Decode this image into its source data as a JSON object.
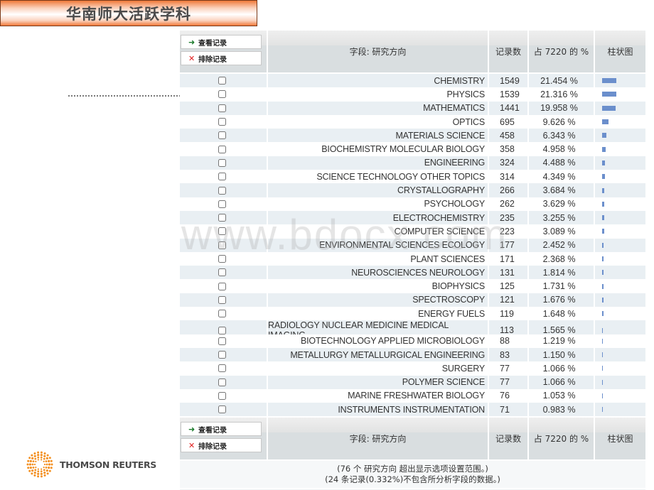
{
  "title": "华南师大活跃学科",
  "logo_text": "THOMSON REUTERS",
  "actions": {
    "view_records": "查看记录",
    "exclude_records": "排除记录"
  },
  "header": {
    "field": "字段: 研究方向",
    "count": "记录数",
    "percent": "占 7220 的 %",
    "bar": "柱状图"
  },
  "total_records": 7220,
  "bar_color": "#6b8fcc",
  "rows": [
    {
      "field": "CHEMISTRY",
      "count": "1549",
      "percent": "21.454 %",
      "pct_value": 21.454,
      "checked": false
    },
    {
      "field": "PHYSICS",
      "count": "1539",
      "percent": "21.316 %",
      "pct_value": 21.316,
      "checked": false
    },
    {
      "field": "MATHEMATICS",
      "count": "1441",
      "percent": "19.958 %",
      "pct_value": 19.958,
      "checked": false
    },
    {
      "field": "OPTICS",
      "count": "695",
      "percent": "9.626 %",
      "pct_value": 9.626,
      "checked": false
    },
    {
      "field": "MATERIALS SCIENCE",
      "count": "458",
      "percent": "6.343 %",
      "pct_value": 6.343,
      "checked": false
    },
    {
      "field": "BIOCHEMISTRY MOLECULAR BIOLOGY",
      "count": "358",
      "percent": "4.958 %",
      "pct_value": 4.958,
      "checked": false
    },
    {
      "field": "ENGINEERING",
      "count": "324",
      "percent": "4.488 %",
      "pct_value": 4.488,
      "checked": false
    },
    {
      "field": "SCIENCE TECHNOLOGY OTHER TOPICS",
      "count": "314",
      "percent": "4.349 %",
      "pct_value": 4.349,
      "checked": false
    },
    {
      "field": "CRYSTALLOGRAPHY",
      "count": "266",
      "percent": "3.684 %",
      "pct_value": 3.684,
      "checked": false
    },
    {
      "field": "PSYCHOLOGY",
      "count": "262",
      "percent": "3.629 %",
      "pct_value": 3.629,
      "checked": false
    },
    {
      "field": "ELECTROCHEMISTRY",
      "count": "235",
      "percent": "3.255 %",
      "pct_value": 3.255,
      "checked": false
    },
    {
      "field": "COMPUTER SCIENCE",
      "count": "223",
      "percent": "3.089 %",
      "pct_value": 3.089,
      "checked": false
    },
    {
      "field": "ENVIRONMENTAL SCIENCES ECOLOGY",
      "count": "177",
      "percent": "2.452 %",
      "pct_value": 2.452,
      "checked": false
    },
    {
      "field": "PLANT SCIENCES",
      "count": "171",
      "percent": "2.368 %",
      "pct_value": 2.368,
      "checked": false
    },
    {
      "field": "NEUROSCIENCES NEUROLOGY",
      "count": "131",
      "percent": "1.814 %",
      "pct_value": 1.814,
      "checked": false
    },
    {
      "field": "BIOPHYSICS",
      "count": "125",
      "percent": "1.731 %",
      "pct_value": 1.731,
      "checked": false
    },
    {
      "field": "SPECTROSCOPY",
      "count": "121",
      "percent": "1.676 %",
      "pct_value": 1.676,
      "checked": false
    },
    {
      "field": "ENERGY FUELS",
      "count": "119",
      "percent": "1.648 %",
      "pct_value": 1.648,
      "checked": false
    },
    {
      "field": "RADIOLOGY NUCLEAR MEDICINE MEDICAL IMAGING",
      "count": "113",
      "percent": "1.565 %",
      "pct_value": 1.565,
      "checked": false
    },
    {
      "field": "BIOTECHNOLOGY APPLIED MICROBIOLOGY",
      "count": "88",
      "percent": "1.219 %",
      "pct_value": 1.219,
      "checked": false
    },
    {
      "field": "METALLURGY METALLURGICAL ENGINEERING",
      "count": "83",
      "percent": "1.150 %",
      "pct_value": 1.15,
      "checked": false
    },
    {
      "field": "SURGERY",
      "count": "77",
      "percent": "1.066 %",
      "pct_value": 1.066,
      "checked": false
    },
    {
      "field": "POLYMER SCIENCE",
      "count": "77",
      "percent": "1.066 %",
      "pct_value": 1.066,
      "checked": false
    },
    {
      "field": "MARINE FRESHWATER BIOLOGY",
      "count": "76",
      "percent": "1.053 %",
      "pct_value": 1.053,
      "checked": false
    },
    {
      "field": "INSTRUMENTS INSTRUMENTATION",
      "count": "71",
      "percent": "0.983 %",
      "pct_value": 0.983,
      "checked": false
    }
  ],
  "notes": {
    "line1": "(76 个 研究方向 超出显示选项设置范围。)",
    "line2": "(24 条记录(0.332%)不包含所分析字段的数据。)"
  },
  "watermark": "www.bdocx.com"
}
